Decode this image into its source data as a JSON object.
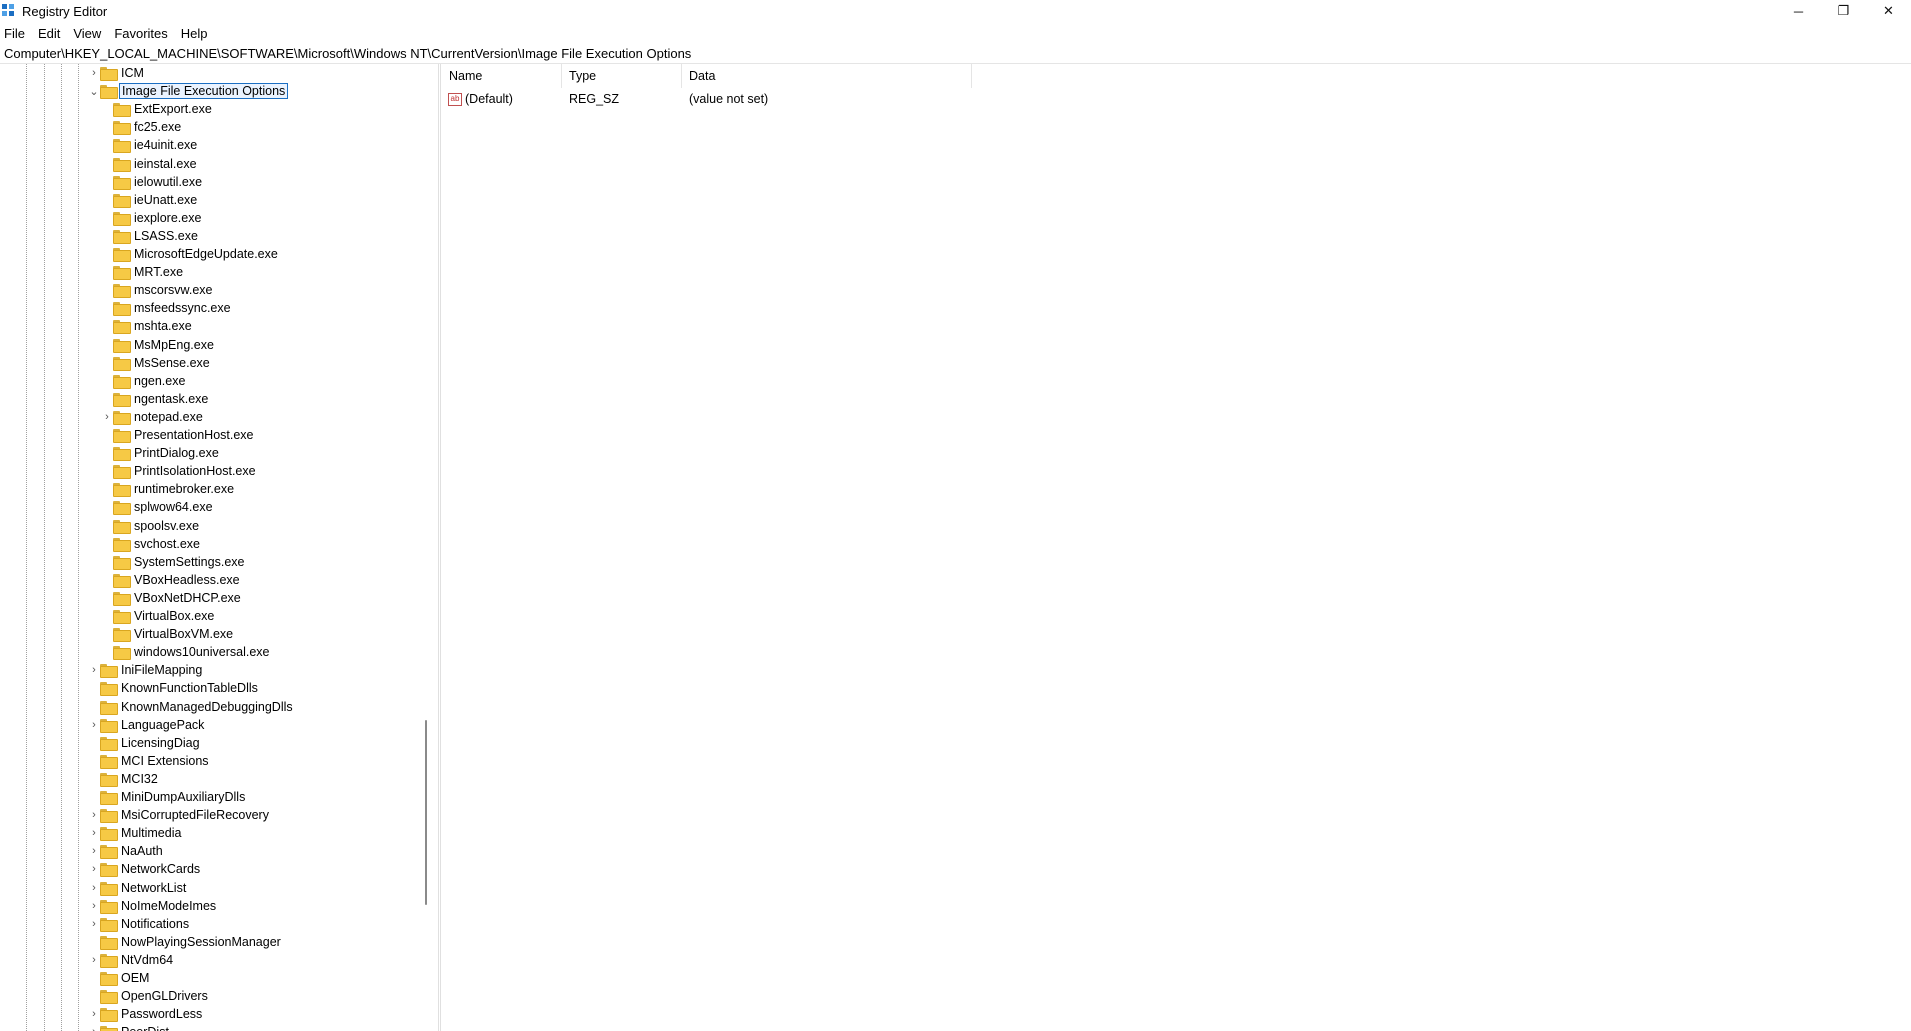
{
  "window": {
    "title": "Registry Editor",
    "controls": {
      "minimize": "─",
      "maximize": "❐",
      "close": "✕"
    }
  },
  "menu": [
    "File",
    "Edit",
    "View",
    "Favorites",
    "Help"
  ],
  "address": "Computer\\HKEY_LOCAL_MACHINE\\SOFTWARE\\Microsoft\\Windows NT\\CurrentVersion\\Image File Execution Options",
  "tree": {
    "before": [
      {
        "label": "ICM",
        "expandable": true
      }
    ],
    "selected": {
      "label": "Image File Execution Options",
      "expanded": true
    },
    "children": [
      {
        "label": "ExtExport.exe",
        "expandable": false
      },
      {
        "label": "fc25.exe",
        "expandable": false
      },
      {
        "label": "ie4uinit.exe",
        "expandable": false
      },
      {
        "label": "ieinstal.exe",
        "expandable": false
      },
      {
        "label": "ielowutil.exe",
        "expandable": false
      },
      {
        "label": "ieUnatt.exe",
        "expandable": false
      },
      {
        "label": "iexplore.exe",
        "expandable": false
      },
      {
        "label": "LSASS.exe",
        "expandable": false
      },
      {
        "label": "MicrosoftEdgeUpdate.exe",
        "expandable": false
      },
      {
        "label": "MRT.exe",
        "expandable": false
      },
      {
        "label": "mscorsvw.exe",
        "expandable": false
      },
      {
        "label": "msfeedssync.exe",
        "expandable": false
      },
      {
        "label": "mshta.exe",
        "expandable": false
      },
      {
        "label": "MsMpEng.exe",
        "expandable": false
      },
      {
        "label": "MsSense.exe",
        "expandable": false
      },
      {
        "label": "ngen.exe",
        "expandable": false
      },
      {
        "label": "ngentask.exe",
        "expandable": false
      },
      {
        "label": "notepad.exe",
        "expandable": true
      },
      {
        "label": "PresentationHost.exe",
        "expandable": false
      },
      {
        "label": "PrintDialog.exe",
        "expandable": false
      },
      {
        "label": "PrintIsolationHost.exe",
        "expandable": false
      },
      {
        "label": "runtimebroker.exe",
        "expandable": false
      },
      {
        "label": "splwow64.exe",
        "expandable": false
      },
      {
        "label": "spoolsv.exe",
        "expandable": false
      },
      {
        "label": "svchost.exe",
        "expandable": false
      },
      {
        "label": "SystemSettings.exe",
        "expandable": false
      },
      {
        "label": "VBoxHeadless.exe",
        "expandable": false
      },
      {
        "label": "VBoxNetDHCP.exe",
        "expandable": false
      },
      {
        "label": "VirtualBox.exe",
        "expandable": false
      },
      {
        "label": "VirtualBoxVM.exe",
        "expandable": false
      },
      {
        "label": "windows10universal.exe",
        "expandable": false
      }
    ],
    "after": [
      {
        "label": "IniFileMapping",
        "expandable": true
      },
      {
        "label": "KnownFunctionTableDlls",
        "expandable": false
      },
      {
        "label": "KnownManagedDebuggingDlls",
        "expandable": false
      },
      {
        "label": "LanguagePack",
        "expandable": true
      },
      {
        "label": "LicensingDiag",
        "expandable": false
      },
      {
        "label": "MCI Extensions",
        "expandable": false
      },
      {
        "label": "MCI32",
        "expandable": false
      },
      {
        "label": "MiniDumpAuxiliaryDlls",
        "expandable": false
      },
      {
        "label": "MsiCorruptedFileRecovery",
        "expandable": true
      },
      {
        "label": "Multimedia",
        "expandable": true
      },
      {
        "label": "NaAuth",
        "expandable": true
      },
      {
        "label": "NetworkCards",
        "expandable": true
      },
      {
        "label": "NetworkList",
        "expandable": true
      },
      {
        "label": "NoImeModeImes",
        "expandable": true
      },
      {
        "label": "Notifications",
        "expandable": true
      },
      {
        "label": "NowPlayingSessionManager",
        "expandable": false
      },
      {
        "label": "NtVdm64",
        "expandable": true
      },
      {
        "label": "OEM",
        "expandable": false
      },
      {
        "label": "OpenGLDrivers",
        "expandable": false
      },
      {
        "label": "PasswordLess",
        "expandable": true
      },
      {
        "label": "PeerDist",
        "expandable": true
      }
    ]
  },
  "list": {
    "columns": [
      "Name",
      "Type",
      "Data"
    ],
    "rows": [
      {
        "name": "(Default)",
        "type": "REG_SZ",
        "data": "(value not set)"
      }
    ]
  },
  "icons": {
    "regsz": "ab",
    "expand": "›",
    "collapse": "⌄"
  }
}
